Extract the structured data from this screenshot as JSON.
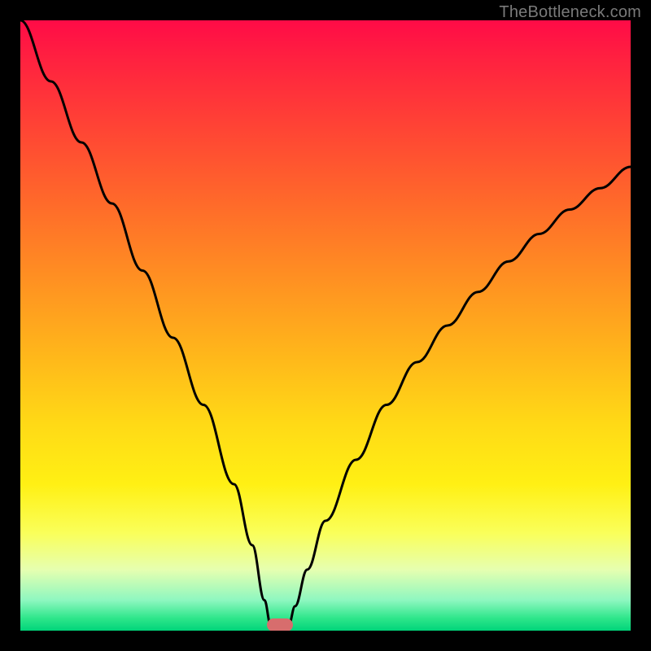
{
  "watermark": "TheBottleneck.com",
  "marker": {
    "x_pct": 42.5,
    "y_pct": 99.1
  },
  "colors": {
    "curve_stroke": "#000000",
    "marker_fill": "#d76d6d",
    "frame_bg": "#000000"
  },
  "chart_data": {
    "type": "line",
    "title": "",
    "xlabel": "",
    "ylabel": "",
    "xlim": [
      0,
      100
    ],
    "ylim": [
      0,
      100
    ],
    "grid": false,
    "legend": false,
    "series": [
      {
        "name": "bottleneck-curve",
        "x": [
          0,
          5,
          10,
          15,
          20,
          25,
          30,
          35,
          38,
          40,
          41,
          44,
          45,
          47,
          50,
          55,
          60,
          65,
          70,
          75,
          80,
          85,
          90,
          95,
          100
        ],
        "y": [
          100,
          90,
          80,
          70,
          59,
          48,
          37,
          24,
          14,
          5,
          1,
          1,
          4,
          10,
          18,
          28,
          37,
          44,
          50,
          55.5,
          60.5,
          65,
          69,
          72.5,
          76
        ]
      }
    ],
    "annotations": [
      {
        "kind": "marker",
        "shape": "pill",
        "x": 42.5,
        "y": 0.9
      }
    ],
    "background_gradient": {
      "direction": "top-to-bottom",
      "stops": [
        {
          "pct": 0,
          "color": "#ff0b47"
        },
        {
          "pct": 18,
          "color": "#ff4534"
        },
        {
          "pct": 42,
          "color": "#ff8f22"
        },
        {
          "pct": 66,
          "color": "#ffd916"
        },
        {
          "pct": 84,
          "color": "#faff5a"
        },
        {
          "pct": 95,
          "color": "#8ef7c0"
        },
        {
          "pct": 100,
          "color": "#00d47a"
        }
      ]
    }
  }
}
